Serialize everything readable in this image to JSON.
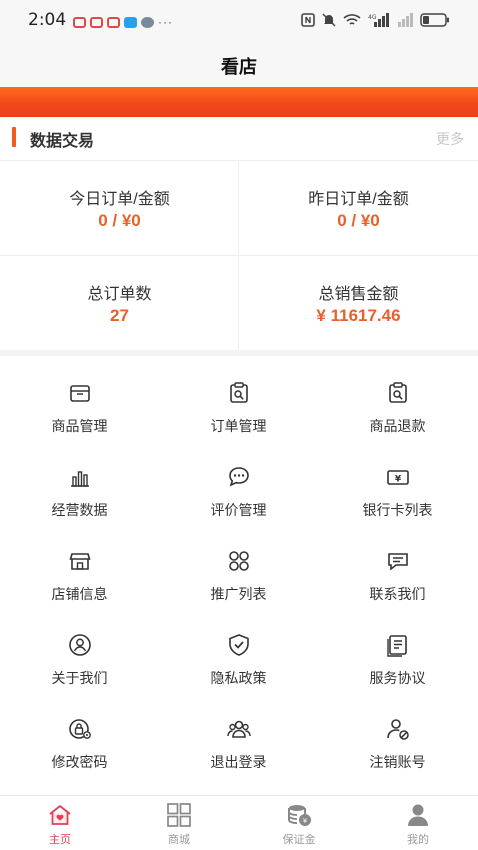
{
  "status_bar": {
    "time": "2:04",
    "more_indicator": "···"
  },
  "header": {
    "title": "看店"
  },
  "data_section": {
    "title": "数据交易",
    "more": "更多",
    "stats": [
      {
        "label": "今日订单/金额",
        "value": "0 / ¥0"
      },
      {
        "label": "昨日订单/金额",
        "value": "0 / ¥0"
      },
      {
        "label": "总订单数",
        "value": "27"
      },
      {
        "label": "总销售金额",
        "value": "¥ 11617.46"
      }
    ]
  },
  "menu": [
    {
      "label": "商品管理",
      "icon": "box-icon"
    },
    {
      "label": "订单管理",
      "icon": "order-search-icon"
    },
    {
      "label": "商品退款",
      "icon": "refund-icon"
    },
    {
      "label": "经营数据",
      "icon": "bar-chart-icon"
    },
    {
      "label": "评价管理",
      "icon": "chat-bubble-icon"
    },
    {
      "label": "银行卡列表",
      "icon": "bank-card-icon"
    },
    {
      "label": "店铺信息",
      "icon": "store-icon"
    },
    {
      "label": "推广列表",
      "icon": "grid-circles-icon"
    },
    {
      "label": "联系我们",
      "icon": "message-icon"
    },
    {
      "label": "关于我们",
      "icon": "user-circle-icon"
    },
    {
      "label": "隐私政策",
      "icon": "shield-check-icon"
    },
    {
      "label": "服务协议",
      "icon": "document-icon"
    },
    {
      "label": "修改密码",
      "icon": "lock-gear-icon"
    },
    {
      "label": "退出登录",
      "icon": "users-icon"
    },
    {
      "label": "注销账号",
      "icon": "user-ban-icon"
    }
  ],
  "tabbar": [
    {
      "label": "主页",
      "icon": "home-icon",
      "active": true
    },
    {
      "label": "商城",
      "icon": "grid-icon",
      "active": false
    },
    {
      "label": "保证金",
      "icon": "coins-icon",
      "active": false
    },
    {
      "label": "我的",
      "icon": "person-icon",
      "active": false
    }
  ],
  "colors": {
    "accent": "#e8612c",
    "banner": "#f0481c",
    "tab_active": "#e23e57"
  }
}
